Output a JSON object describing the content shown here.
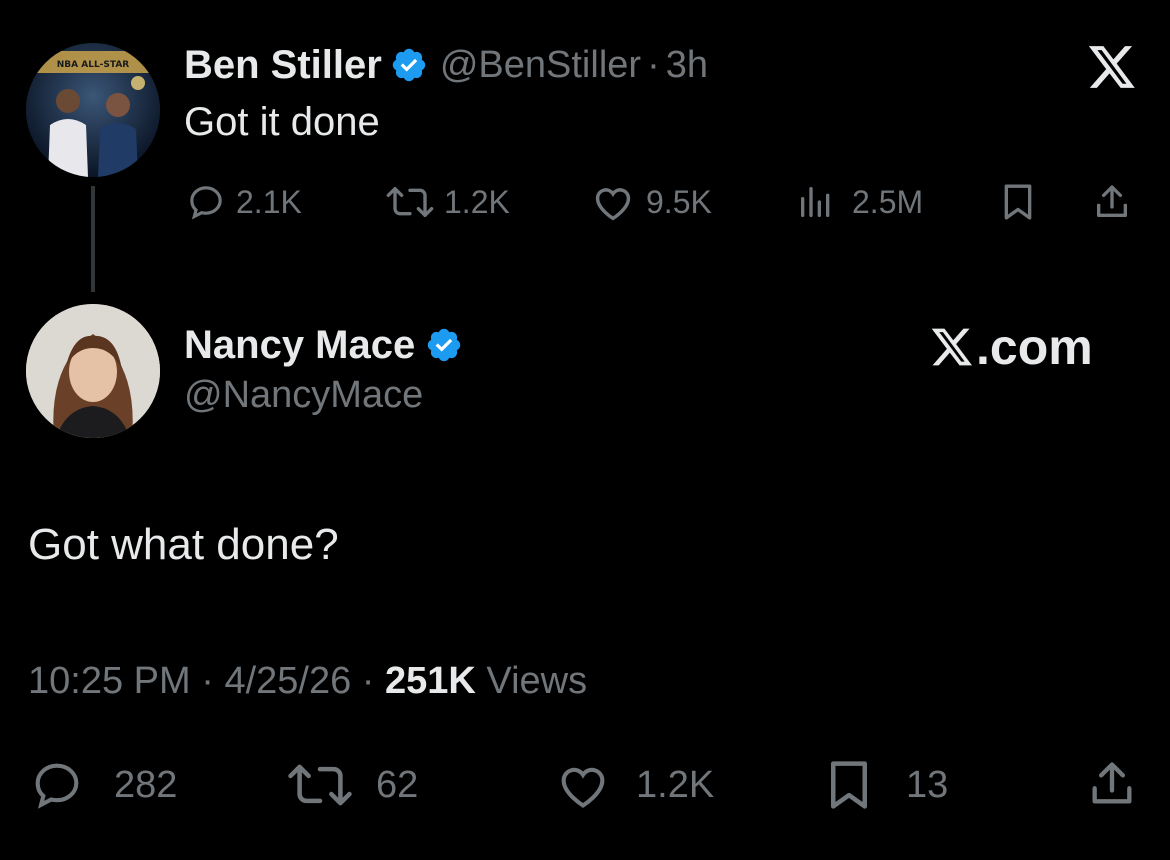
{
  "parent_tweet": {
    "display_name": "Ben Stiller",
    "handle": "@BenStiller",
    "separator": "·",
    "time_ago": "3h",
    "text": "Got it done",
    "avatar": {
      "icon": "profile-photo-two-basketball-players",
      "banner_text": "NBA ALL-STAR"
    },
    "stats": {
      "replies": "2.1K",
      "reposts": "1.2K",
      "likes": "9.5K",
      "views": "2.5M"
    }
  },
  "reply_tweet": {
    "display_name": "Nancy Mace",
    "handle": "@NancyMace",
    "text": "Got what done?",
    "timestamp_time": "10:25 PM",
    "timestamp_sep1": "·",
    "timestamp_date": "4/25/26",
    "timestamp_sep2": "·",
    "views_count": "251K",
    "views_label": "Views",
    "avatar": {
      "icon": "profile-photo-woman"
    },
    "stats": {
      "replies": "282",
      "reposts": "62",
      "likes": "1.2K",
      "bookmarks": "13"
    }
  },
  "watermark": {
    "logo": "𝕏",
    "text": "X.com"
  },
  "colors": {
    "background": "#000000",
    "text": "#e7e9ea",
    "muted": "#71767b",
    "verified": "#1d9bf0"
  }
}
